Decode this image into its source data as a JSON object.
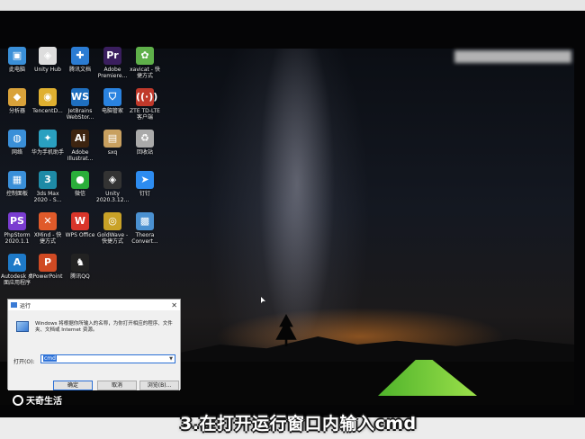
{
  "desktop": {
    "icons": [
      {
        "label": "此电脑",
        "glyph": "▣",
        "color": "#3a8fd8"
      },
      {
        "label": "Unity Hub",
        "glyph": "◈",
        "color": "#dddddd"
      },
      {
        "label": "腾讯文档",
        "glyph": "✚",
        "color": "#2b7cd3"
      },
      {
        "label": "Adobe\nPremiere...",
        "glyph": "Pr",
        "color": "#3a1e5e"
      },
      {
        "label": "xavicat - 快\n捷方式",
        "glyph": "✿",
        "color": "#5fb04a"
      },
      {
        "label": "分析器",
        "glyph": "◆",
        "color": "#d9a23a"
      },
      {
        "label": "TencentD...",
        "glyph": "◉",
        "color": "#e0b030"
      },
      {
        "label": "JetBrains\nWebStor...",
        "glyph": "WS",
        "color": "#1f6fbf"
      },
      {
        "label": "电脑管家",
        "glyph": "⛉",
        "color": "#2a83e0"
      },
      {
        "label": "ZTE TD-LTE\n客户端",
        "glyph": "((·))",
        "color": "#c0392b"
      },
      {
        "label": "网络",
        "glyph": "◍",
        "color": "#3a8fd8"
      },
      {
        "label": "华为手机助手",
        "glyph": "✦",
        "color": "#2aa0c0"
      },
      {
        "label": "Adobe\nIllustrat...",
        "glyph": "Ai",
        "color": "#3d2410"
      },
      {
        "label": "sxq",
        "glyph": "▤",
        "color": "#c8a060"
      },
      {
        "label": "回收站",
        "glyph": "♻",
        "color": "#aaaaaa"
      },
      {
        "label": "控制面板",
        "glyph": "▦",
        "color": "#3a8fd8"
      },
      {
        "label": "3ds Max\n2020 - S...",
        "glyph": "3",
        "color": "#1e8aa6"
      },
      {
        "label": "微信",
        "glyph": "●",
        "color": "#2aae3a"
      },
      {
        "label": "Unity\n2020.3.12...",
        "glyph": "◈",
        "color": "#333333"
      },
      {
        "label": "钉钉",
        "glyph": "➤",
        "color": "#2d8cf0"
      },
      {
        "label": "PhpStorm\n2020.1.1",
        "glyph": "PS",
        "color": "#7a3cd0"
      },
      {
        "label": "XMind - 快\n捷方式",
        "glyph": "✕",
        "color": "#e05a2a"
      },
      {
        "label": "WPS Office",
        "glyph": "W",
        "color": "#d9352a"
      },
      {
        "label": "GoldWave -\n快捷方式",
        "glyph": "◎",
        "color": "#c9a227"
      },
      {
        "label": "Theora\nConvert...",
        "glyph": "▩",
        "color": "#4a90d0"
      },
      {
        "label": "Autodesk 桌\n面应用程序",
        "glyph": "A",
        "color": "#1e7ac8"
      },
      {
        "label": "PowerPoint",
        "glyph": "P",
        "color": "#d04a23"
      },
      {
        "label": "腾讯QQ",
        "glyph": "♞",
        "color": "#222222"
      }
    ],
    "blurred_label": ""
  },
  "run_dialog": {
    "title": "运行",
    "close_glyph": "✕",
    "description": "Windows 将根据你所输入的名称，为你打开相应的程序、文件夹、文档或 Internet 资源。",
    "open_label": "打开(O):",
    "input_value": "cmd",
    "ok_label": "确定",
    "cancel_label": "取消",
    "browse_label": "浏览(B)..."
  },
  "watermark": {
    "text": "天奇生活"
  },
  "caption": {
    "text": "3.在打开运行窗口内输入cmd"
  }
}
